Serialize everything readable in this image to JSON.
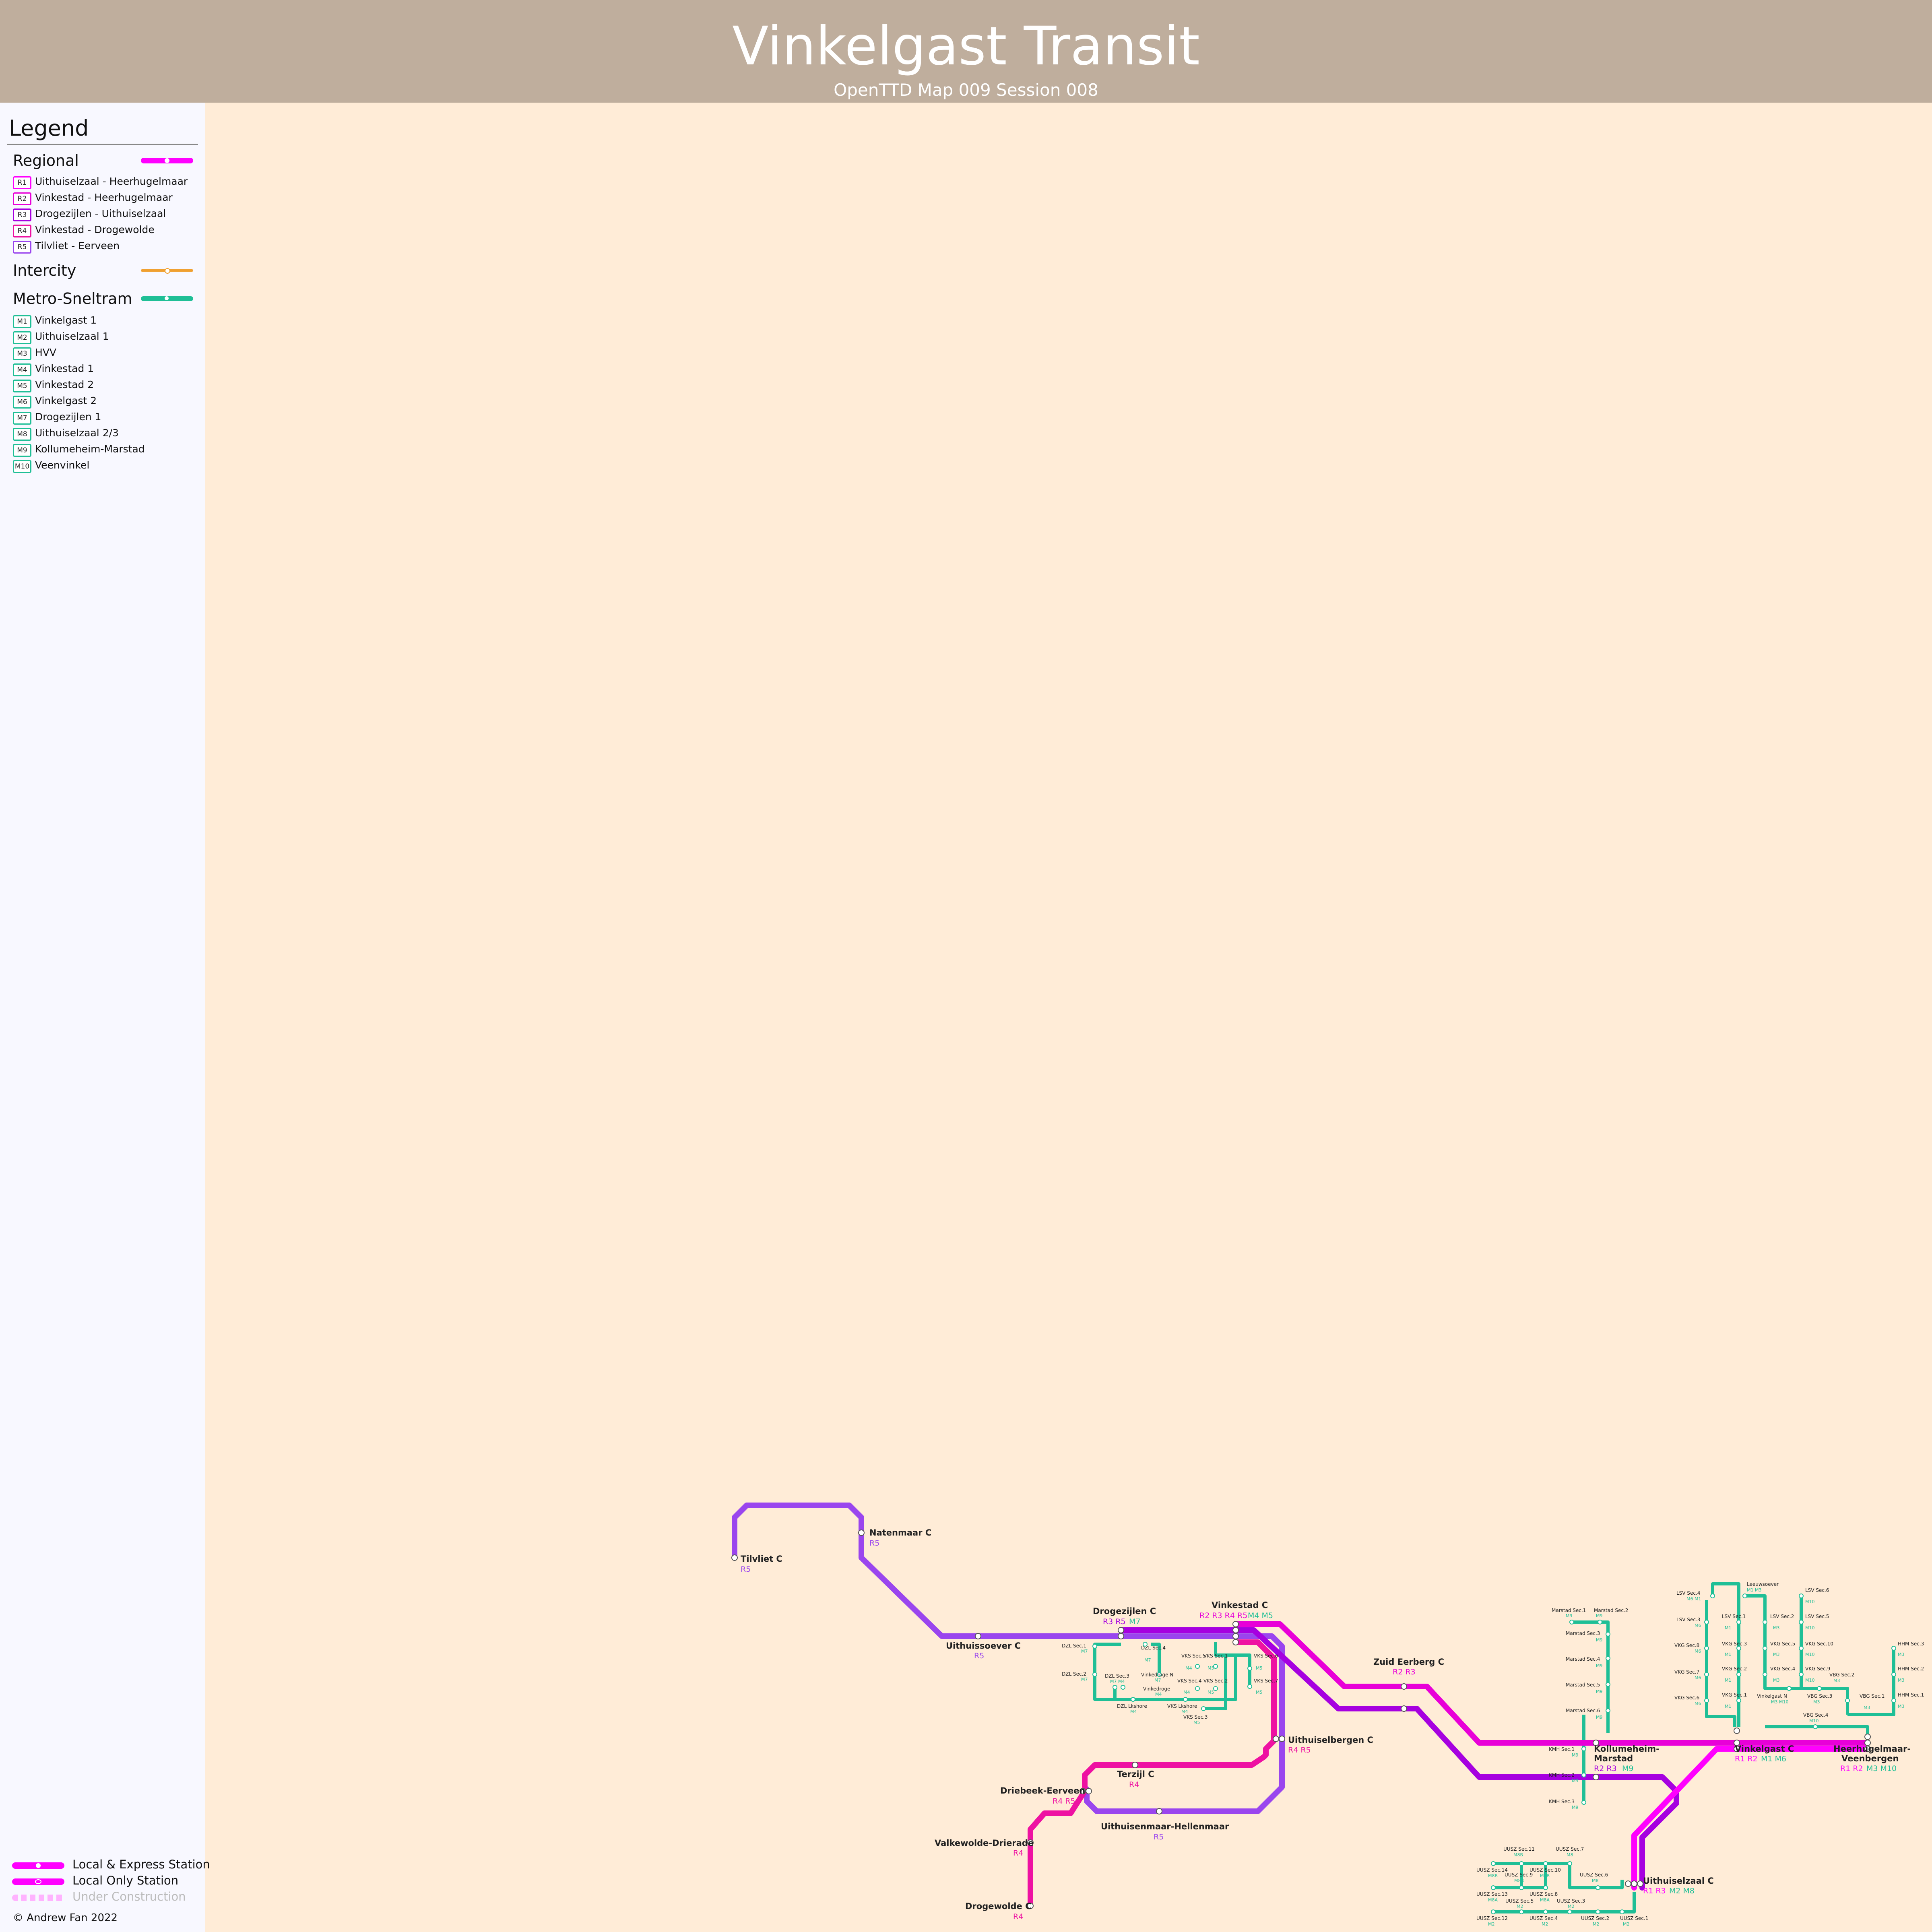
{
  "header": {
    "title": "Vinkelgast Transit",
    "subtitle": "OpenTTD Map 009 Session 008"
  },
  "legend": {
    "title": "Legend",
    "regional": {
      "label": "Regional",
      "color": "#ff00ff",
      "routes": [
        {
          "code": "R1",
          "name": "Uithuiselzaal - Heerhugelmaar",
          "color": "#ff00ff"
        },
        {
          "code": "R2",
          "name": "Vinkestad - Heerhugelmaar",
          "color": "#e800d8"
        },
        {
          "code": "R3",
          "name": "Drogezijlen - Uithuiselzaal",
          "color": "#a600e0"
        },
        {
          "code": "R4",
          "name": "Vinkestad - Drogewolde",
          "color": "#ee11a2"
        },
        {
          "code": "R5",
          "name": "Tilvliet - Eerveen",
          "color": "#9a45ee"
        }
      ]
    },
    "intercity": {
      "label": "Intercity",
      "color": "#f0a030"
    },
    "metro": {
      "label": "Metro-Sneltram",
      "color": "#1fbf96",
      "routes": [
        {
          "code": "M1",
          "name": "Vinkelgast 1"
        },
        {
          "code": "M2",
          "name": "Uithuiselzaal 1"
        },
        {
          "code": "M3",
          "name": "HVV"
        },
        {
          "code": "M4",
          "name": "Vinkestad 1"
        },
        {
          "code": "M5",
          "name": "Vinkestad 2"
        },
        {
          "code": "M6",
          "name": "Vinkelgast 2"
        },
        {
          "code": "M7",
          "name": "Drogezijlen 1"
        },
        {
          "code": "M8",
          "name": "Uithuiselzaal 2/3"
        },
        {
          "code": "M9",
          "name": "Kollumeheim-Marstad"
        },
        {
          "code": "M10",
          "name": "Veenvinkel"
        }
      ]
    },
    "key": {
      "local_express": "Local & Express Station",
      "local_only": "Local Only Station",
      "under_construction": "Under Construction"
    },
    "credit": "© Andrew Fan 2022"
  },
  "stations": {
    "tilvliet": {
      "name": "Tilvliet C",
      "lines": "R5"
    },
    "natenmaar": {
      "name": "Natenmaar C",
      "lines": "R5"
    },
    "uithuissoever": {
      "name": "Uithuissoever C",
      "lines": "R5"
    },
    "drogezijlen": {
      "name": "Drogezijlen C",
      "lines_r": "R3 R5",
      "lines_m": "M7"
    },
    "vinkestad": {
      "name": "Vinkestad C",
      "lines_r": "R2 R3 R4 R5",
      "lines_m": "M4 M5"
    },
    "zuid_eerberg": {
      "name": "Zuid Eerberg C",
      "lines": "R2 R3"
    },
    "uithuiselbergen": {
      "name": "Uithuiselbergen C",
      "lines": "R4 R5"
    },
    "terzijl": {
      "name": "Terzijl C",
      "lines": "R4"
    },
    "driebeek": {
      "name": "Driebeek-Eerveen",
      "lines": "R4 R5"
    },
    "uithuisenmaar": {
      "name": "Uithuisenmaar-Hellenmaar",
      "lines": "R5"
    },
    "valkewolde": {
      "name": "Valkewolde-Drierade",
      "lines": "R4"
    },
    "drogewolde": {
      "name": "Drogewolde C",
      "lines": "R4"
    },
    "kollumeheim": {
      "name1": "Kollumeheim-",
      "name2": "Marstad",
      "lines_r": "R2 R3",
      "lines_m": "M9"
    },
    "vinkelgast": {
      "name": "Vinkelgast C",
      "lines_r": "R1 R2",
      "lines_m": "M1 M6"
    },
    "heerhugelmaar": {
      "name1": "Heerhugelmaar-",
      "name2": "Veenbergen",
      "lines_r": "R1 R2",
      "lines_m": "M3 M10"
    },
    "uithuiselzaal": {
      "name": "Uithuiselzaal C",
      "lines_r": "R1 R3",
      "lines_m": "M2 M8"
    }
  },
  "metro_stations": {
    "dzl": [
      {
        "name": "DZL Sec.1",
        "line": "M7"
      },
      {
        "name": "DZL Sec.4",
        "line": "M7"
      },
      {
        "name": "DZL Sec.2",
        "line": "M7"
      },
      {
        "name": "DZL Sec.3",
        "line": "M7 M4"
      },
      {
        "name": "DZL Lkshore",
        "line": "M4"
      },
      {
        "name": "Vinkedroge N",
        "line": "M7"
      },
      {
        "name": "Vinkedroge",
        "line": "M4"
      }
    ],
    "vks": [
      {
        "name": "VKS Sec.5",
        "line": "M4"
      },
      {
        "name": "VKS Sec.1",
        "line": "M5"
      },
      {
        "name": "VKS Sec.6",
        "line": "M5"
      },
      {
        "name": "VKS Sec.4",
        "line": "M4"
      },
      {
        "name": "VKS Sec.2",
        "line": "M5"
      },
      {
        "name": "VKS Sec.7",
        "line": "M5"
      },
      {
        "name": "VKS Lkshore",
        "line": "M4"
      },
      {
        "name": "VKS Sec.3",
        "line": "M5"
      }
    ],
    "marstad": [
      {
        "name": "Marstad Sec.1",
        "line": "M9"
      },
      {
        "name": "Marstad Sec.2",
        "line": "M9"
      },
      {
        "name": "Marstad Sec.3",
        "line": "M9"
      },
      {
        "name": "Marstad Sec.4",
        "line": "M9"
      },
      {
        "name": "Marstad Sec.5",
        "line": "M9"
      },
      {
        "name": "Marstad Sec.6",
        "line": "M9"
      },
      {
        "name": "KMH Sec.1",
        "line": "M9"
      },
      {
        "name": "KMH Sec.2",
        "line": "M9"
      },
      {
        "name": "KMH Sec.3",
        "line": "M9"
      }
    ],
    "vkg": [
      {
        "name": "LSV Sec.4",
        "line": "M6 M1"
      },
      {
        "name": "Leeuwsoever",
        "line": "M1 M3"
      },
      {
        "name": "LSV Sec.3",
        "line": "M6"
      },
      {
        "name": "LSV Sec.1",
        "line": "M1"
      },
      {
        "name": "LSV Sec.2",
        "line": "M3"
      },
      {
        "name": "LSV Sec.6",
        "line": "M10"
      },
      {
        "name": "LSV Sec.5",
        "line": "M10"
      },
      {
        "name": "VKG Sec.8",
        "line": "M6"
      },
      {
        "name": "VKG Sec.3",
        "line": "M1"
      },
      {
        "name": "VKG Sec.5",
        "line": "M3"
      },
      {
        "name": "VKG Sec.10",
        "line": "M10"
      },
      {
        "name": "VKG Sec.7",
        "line": "M6"
      },
      {
        "name": "VKG Sec.2",
        "line": "M1"
      },
      {
        "name": "VKG Sec.4",
        "line": "M3"
      },
      {
        "name": "VKG Sec.9",
        "line": "M10"
      },
      {
        "name": "VBG Sec.2",
        "line": "M3"
      },
      {
        "name": "VKG Sec.6",
        "line": "M6"
      },
      {
        "name": "VKG Sec.1",
        "line": "M1"
      },
      {
        "name": "Vinkelgast N",
        "line": "M3 M10"
      },
      {
        "name": "VBG Sec.3",
        "line": "M3"
      },
      {
        "name": "VBG Sec.1",
        "line": "M3"
      },
      {
        "name": "VBG Sec.4",
        "line": "M10"
      },
      {
        "name": "HHM Sec.3",
        "line": "M3"
      },
      {
        "name": "HHM Sec.2",
        "line": "M3"
      },
      {
        "name": "HHM Sec.1",
        "line": "M3"
      }
    ],
    "uusz": [
      {
        "name": "UUSZ Sec.11",
        "line": "M8B"
      },
      {
        "name": "UUSZ Sec.7",
        "line": "M8"
      },
      {
        "name": "UUSZ Sec.14",
        "line": "M8B"
      },
      {
        "name": "UUSZ Sec.9",
        "line": "M8B"
      },
      {
        "name": "UUSZ Sec.10",
        "line": "M8B"
      },
      {
        "name": "UUSZ Sec.6",
        "line": "M8"
      },
      {
        "name": "UUSZ Sec.13",
        "line": "M8A"
      },
      {
        "name": "UUSZ Sec.8",
        "line": "M8A"
      },
      {
        "name": "UUSZ Sec.5",
        "line": "M2"
      },
      {
        "name": "UUSZ Sec.3",
        "line": "M2"
      },
      {
        "name": "UUSZ Sec.12",
        "line": "M2"
      },
      {
        "name": "UUSZ Sec.4",
        "line": "M2"
      },
      {
        "name": "UUSZ Sec.2",
        "line": "M2"
      },
      {
        "name": "UUSZ Sec.1",
        "line": "M2"
      }
    ]
  }
}
